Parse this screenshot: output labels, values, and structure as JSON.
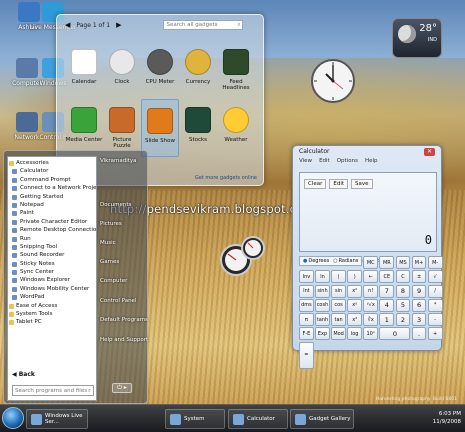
{
  "desktop": {
    "icons": [
      {
        "label": "Ashwin"
      },
      {
        "label": "Live Messenger"
      },
      {
        "label": "Computer"
      },
      {
        "label": "Windows"
      },
      {
        "label": "Network"
      },
      {
        "label": "Control P"
      }
    ],
    "watermark": "http://pendsevikram.blogspot.com",
    "credit": "Harvesting photography. Build 6801"
  },
  "gadget_gallery": {
    "page_label": "Page 1 of 1",
    "search_placeholder": "Search all gadgets",
    "more_link": "Get more gadgets online",
    "gadgets": [
      {
        "label": "Calendar",
        "color": "#ffffff"
      },
      {
        "label": "Clock",
        "color": "#e8e8e8"
      },
      {
        "label": "CPU Meter",
        "color": "#5a5a5a"
      },
      {
        "label": "Currency",
        "color": "#e0b33c"
      },
      {
        "label": "Feed Headlines",
        "color": "#2f4a2a"
      },
      {
        "label": "Media Center",
        "color": "#3aa33a"
      },
      {
        "label": "Picture Puzzle",
        "color": "#c86a2a"
      },
      {
        "label": "Slide Show",
        "color": "#e07a1a"
      },
      {
        "label": "Stocks",
        "color": "#1f4a3a"
      },
      {
        "label": "Weather",
        "color": "#ffcc33"
      }
    ]
  },
  "start_menu": {
    "programs": [
      {
        "label": "Accessories",
        "folder": true
      },
      {
        "label": "Calculator"
      },
      {
        "label": "Command Prompt"
      },
      {
        "label": "Connect to a Network Projector"
      },
      {
        "label": "Getting Started"
      },
      {
        "label": "Notepad"
      },
      {
        "label": "Paint"
      },
      {
        "label": "Private Character Editor"
      },
      {
        "label": "Remote Desktop Connection"
      },
      {
        "label": "Run"
      },
      {
        "label": "Snipping Tool"
      },
      {
        "label": "Sound Recorder"
      },
      {
        "label": "Sticky Notes"
      },
      {
        "label": "Sync Center"
      },
      {
        "label": "Windows Explorer"
      },
      {
        "label": "Windows Mobility Center"
      },
      {
        "label": "WordPad"
      },
      {
        "label": "Ease of Access",
        "folder": true
      },
      {
        "label": "System Tools",
        "folder": true
      },
      {
        "label": "Tablet PC",
        "folder": true
      }
    ],
    "back_label": "Back",
    "search_placeholder": "Search programs and files",
    "right_items": [
      {
        "label": "Vikramaditya"
      },
      {
        "label": "Documents"
      },
      {
        "label": "Pictures"
      },
      {
        "label": "Music"
      },
      {
        "label": "Games"
      },
      {
        "label": "Computer"
      },
      {
        "label": "Control Panel"
      },
      {
        "label": "Default Programs"
      },
      {
        "label": "Help and Support"
      }
    ]
  },
  "calculator": {
    "title": "Calculator",
    "menu": [
      "View",
      "Edit",
      "Options",
      "Help"
    ],
    "mini_buttons": [
      "Clear",
      "Edit",
      "Save"
    ],
    "display_value": "0",
    "modes": [
      "Degrees",
      "Radians",
      "Grads"
    ],
    "selected_mode": "Degrees",
    "keys": [
      "",
      "",
      "",
      "",
      "MC",
      "MR",
      "MS",
      "M+",
      "M-",
      "Inv",
      "ln",
      "(",
      ")",
      "←",
      "CE",
      "C",
      "±",
      "√",
      "Int",
      "sinh",
      "sin",
      "x²",
      "n!",
      "7",
      "8",
      "9",
      "/",
      "dms",
      "cosh",
      "cos",
      "xʸ",
      "ʸ√x",
      "4",
      "5",
      "6",
      "*",
      "π",
      "tanh",
      "tan",
      "x³",
      "∛x",
      "1",
      "2",
      "3",
      "-",
      "F-E",
      "Exp",
      "Mod",
      "log",
      "10ˣ",
      "0",
      ".",
      "+",
      "="
    ]
  },
  "weather": {
    "temperature": "28°",
    "city": "IND"
  },
  "taskbar": {
    "buttons": [
      {
        "label": "Windows Live Ser..."
      },
      {
        "label": "System"
      },
      {
        "label": "Calculator"
      },
      {
        "label": "Gadget Gallery"
      }
    ],
    "time": "6:03 PM",
    "date": "11/9/2008"
  }
}
